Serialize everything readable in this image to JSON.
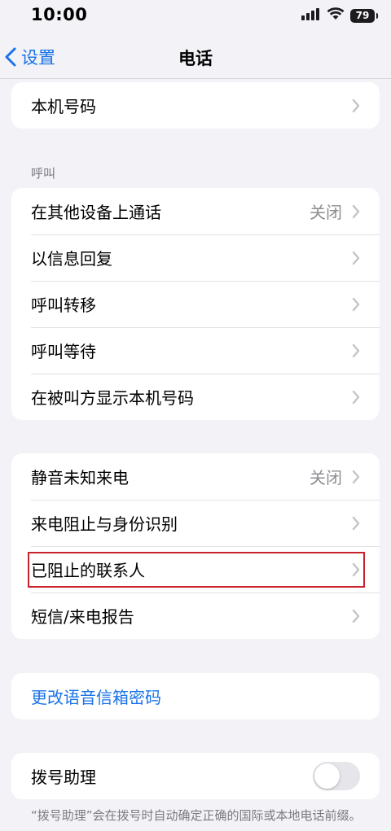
{
  "status_bar": {
    "time": "10:00",
    "battery": "79"
  },
  "nav": {
    "back_label": "设置",
    "title": "电话"
  },
  "group_top": {
    "rows": [
      {
        "label": "本机号码"
      }
    ]
  },
  "section_calls": {
    "header": "呼叫"
  },
  "group_calls": {
    "rows": [
      {
        "label": "在其他设备上通话",
        "value": "关闭"
      },
      {
        "label": "以信息回复"
      },
      {
        "label": "呼叫转移"
      },
      {
        "label": "呼叫等待"
      },
      {
        "label": "在被叫方显示本机号码"
      }
    ]
  },
  "group_blocking": {
    "rows": [
      {
        "label": "静音未知来电",
        "value": "关闭"
      },
      {
        "label": "来电阻止与身份识别"
      },
      {
        "label": "已阻止的联系人"
      },
      {
        "label": "短信/来电报告"
      }
    ]
  },
  "group_voicemail": {
    "rows": [
      {
        "label": "更改语音信箱密码"
      }
    ]
  },
  "group_dial": {
    "rows": [
      {
        "label": "拨号助理",
        "toggle_on": false
      }
    ]
  },
  "footer": {
    "note": "“拨号助理”会在拨号时自动确定正确的国际或本地电话前缀。"
  },
  "colors": {
    "accent": "#1a73e8",
    "highlight": "#c8232c",
    "background": "#f2f2f7"
  }
}
